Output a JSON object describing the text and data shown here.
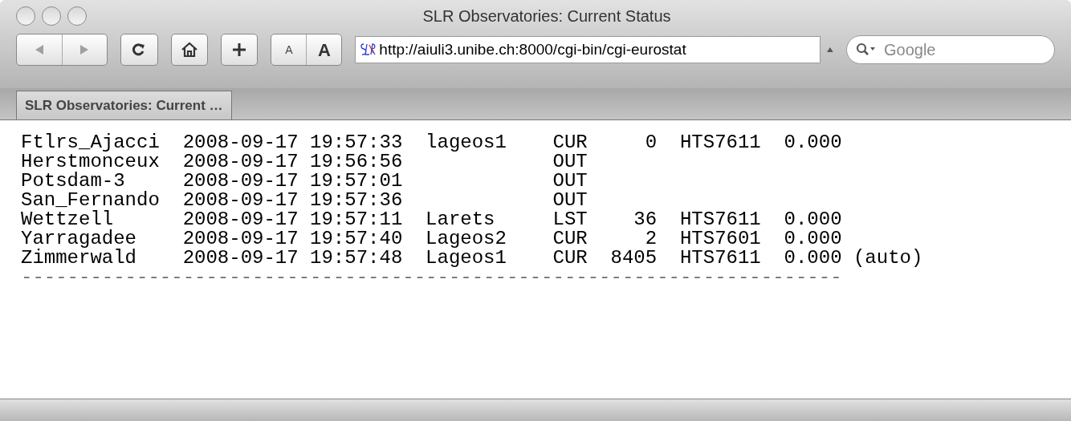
{
  "window": {
    "title": "SLR Observatories: Current Status"
  },
  "toolbar": {
    "address": "http://aiuli3.unibe.ch:8000/cgi-bin/cgi-eurostat",
    "search": {
      "placeholder": "Google"
    },
    "text_smaller": "A",
    "text_bigger": "A"
  },
  "tabs": [
    {
      "label": "SLR Observatories: Current …",
      "selected": true
    }
  ],
  "rows": [
    {
      "station": "Ftlrs_Ajacci",
      "time": "2008-09-17 19:57:33",
      "satellite": "lageos1",
      "status": "CUR",
      "count": "0",
      "model": "HTS7611",
      "value": "0.000"
    },
    {
      "station": "Herstmonceux",
      "time": "2008-09-17 19:56:56",
      "status": "OUT"
    },
    {
      "station": "Potsdam-3",
      "time": "2008-09-17 19:57:01",
      "status": "OUT"
    },
    {
      "station": "San_Fernando",
      "time": "2008-09-17 19:57:36",
      "status": "OUT"
    },
    {
      "station": "Wettzell",
      "time": "2008-09-17 19:57:11",
      "satellite": "Larets",
      "status": "LST",
      "count": "36",
      "model": "HTS7611",
      "value": "0.000"
    },
    {
      "station": "Yarragadee",
      "time": "2008-09-17 19:57:40",
      "satellite": "Lageos2",
      "status": "CUR",
      "count": "2",
      "model": "HTS7601",
      "value": "0.000"
    },
    {
      "station": "Zimmerwald",
      "time": "2008-09-17 19:57:48",
      "satellite": "Lageos1",
      "status": "CUR",
      "count": "8405",
      "model": "HTS7611",
      "value": "0.000",
      "note": "(auto)"
    }
  ],
  "separator": "-----------------------------------------------------------------------"
}
